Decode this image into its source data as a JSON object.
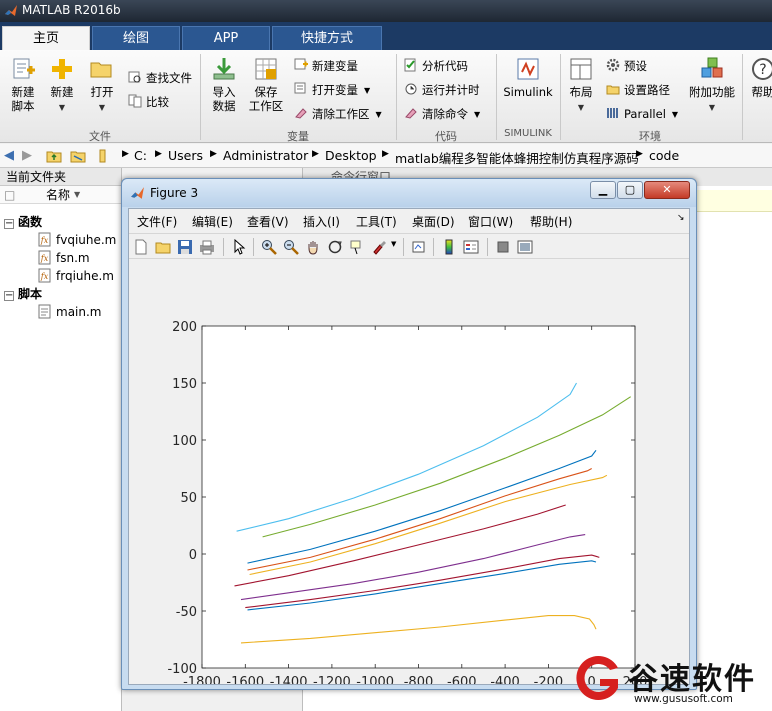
{
  "app": {
    "title": "MATLAB R2016b"
  },
  "tabs": [
    {
      "label": "主页",
      "active": true
    },
    {
      "label": "绘图",
      "active": false
    },
    {
      "label": "APP",
      "active": false
    },
    {
      "label": "快捷方式",
      "active": false
    }
  ],
  "ribbon": {
    "file": {
      "label": "文件",
      "new_script": "新建\n脚本",
      "new": "新建",
      "open": "打开",
      "find_files": "查找文件",
      "compare": "比较"
    },
    "variable": {
      "label": "变量",
      "import_data": "导入\n数据",
      "save_workspace": "保存\n工作区",
      "new_variable": "新建变量",
      "open_variable": "打开变量",
      "clear_workspace": "清除工作区"
    },
    "code": {
      "label": "代码",
      "analyze_code": "分析代码",
      "run_and_time": "运行并计时",
      "clear_commands": "清除命令"
    },
    "simulink": {
      "label": "SIMULINK",
      "button": "Simulink"
    },
    "environment": {
      "label": "环境",
      "layout": "布局",
      "preferences": "预设",
      "set_path": "设置路径",
      "parallel": "Parallel",
      "addons": "附加功能"
    },
    "resources": {
      "help": "帮助"
    }
  },
  "address": {
    "crumbs": [
      "C:",
      "Users",
      "Administrator",
      "Desktop",
      "matlab编程多智能体蜂拥控制仿真程序源码",
      "code"
    ]
  },
  "current_folder": {
    "title": "当前文件夹",
    "column_name": "名称",
    "groups": [
      {
        "label": "函数",
        "files": [
          "fvqiuhe.m",
          "fsn.m",
          "frqiuhe.m"
        ]
      },
      {
        "label": "脚本",
        "files": [
          "main.m"
        ]
      }
    ]
  },
  "command_window": {
    "title": "命令行窗口"
  },
  "figure": {
    "title": "Figure 3",
    "menus": [
      "文件(F)",
      "编辑(E)",
      "查看(V)",
      "插入(I)",
      "工具(T)",
      "桌面(D)",
      "窗口(W)",
      "帮助(H)"
    ]
  },
  "chart_data": {
    "type": "line",
    "title": "",
    "xlabel": "",
    "ylabel": "",
    "xlim": [
      -1800,
      200
    ],
    "ylim": [
      -100,
      200
    ],
    "xticks": [
      -1800,
      -1600,
      -1400,
      -1200,
      -1000,
      -800,
      -600,
      -400,
      -200,
      0,
      200
    ],
    "yticks": [
      -100,
      -50,
      0,
      50,
      100,
      150,
      200
    ],
    "grid": false,
    "series": [
      {
        "color": "#4dbeee",
        "x": [
          -1640,
          -1400,
          -1100,
          -800,
          -500,
          -250,
          -100,
          -70
        ],
        "y": [
          20,
          31,
          49,
          70,
          95,
          120,
          140,
          150
        ]
      },
      {
        "color": "#77ac30",
        "x": [
          -1520,
          -1300,
          -1000,
          -700,
          -400,
          -150,
          50,
          180
        ],
        "y": [
          15,
          26,
          43,
          62,
          84,
          104,
          122,
          138
        ]
      },
      {
        "color": "#0072bd",
        "x": [
          -1590,
          -1300,
          -1000,
          -700,
          -400,
          -150,
          0,
          20
        ],
        "y": [
          -8,
          4,
          20,
          38,
          58,
          75,
          86,
          91
        ]
      },
      {
        "color": "#d95319",
        "x": [
          -1590,
          -1300,
          -1000,
          -700,
          -400,
          -150,
          -20,
          0
        ],
        "y": [
          -14,
          -3,
          13,
          31,
          51,
          66,
          73,
          75
        ]
      },
      {
        "color": "#edb120",
        "x": [
          -1580,
          -1300,
          -1000,
          -700,
          -400,
          -100,
          50,
          70
        ],
        "y": [
          -18,
          -7,
          9,
          27,
          46,
          61,
          67,
          69
        ]
      },
      {
        "color": "#a2142f",
        "x": [
          -1650,
          -1400,
          -1100,
          -800,
          -500,
          -250,
          -120
        ],
        "y": [
          -28,
          -19,
          -6,
          8,
          22,
          35,
          43
        ]
      },
      {
        "color": "#7e2f8e",
        "x": [
          -1620,
          -1400,
          -1100,
          -800,
          -500,
          -250,
          -100,
          -30
        ],
        "y": [
          -40,
          -34,
          -26,
          -16,
          -4,
          8,
          15,
          17
        ]
      },
      {
        "color": "#a2142f",
        "x": [
          -1600,
          -1300,
          -1000,
          -700,
          -400,
          -150,
          0,
          20,
          35
        ],
        "y": [
          -47,
          -40,
          -32,
          -23,
          -13,
          -4,
          -1,
          -2,
          -3
        ]
      },
      {
        "color": "#0072bd",
        "x": [
          -1590,
          -1300,
          -1000,
          -700,
          -400,
          -150,
          0,
          20
        ],
        "y": [
          -49,
          -43,
          -35,
          -26,
          -17,
          -9,
          -6,
          -7
        ]
      },
      {
        "color": "#edb120",
        "x": [
          -1620,
          -1300,
          -1000,
          -700,
          -400,
          -200,
          -80,
          -10,
          10,
          20
        ],
        "y": [
          -78,
          -74,
          -69,
          -64,
          -58,
          -54,
          -54,
          -57,
          -62,
          -66
        ]
      }
    ]
  },
  "watermark": {
    "name": "谷速软件",
    "url": "www.gususoft.com"
  }
}
